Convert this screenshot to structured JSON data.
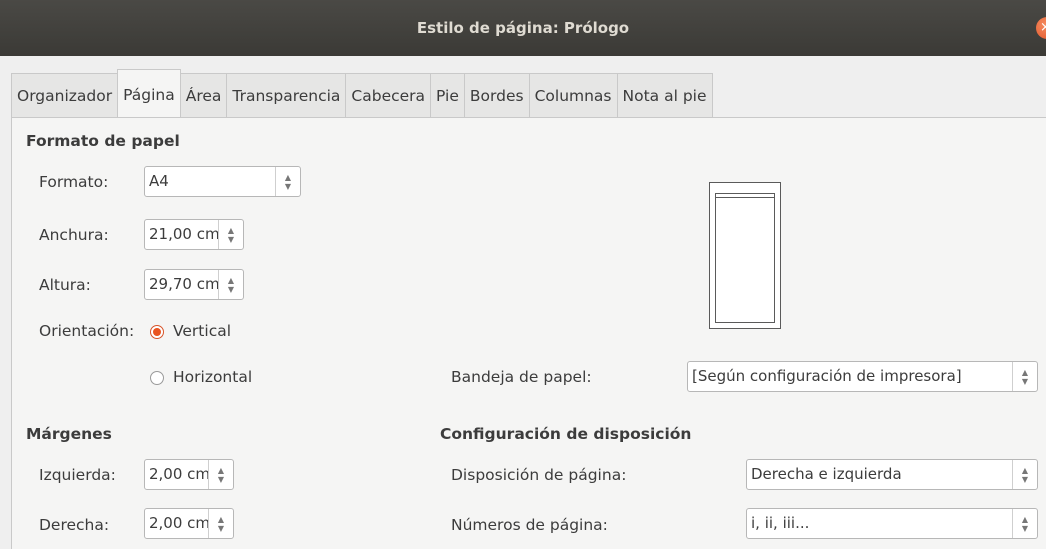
{
  "window": {
    "title": "Estilo de página: Prólogo",
    "close_symbol": "×"
  },
  "tabs": [
    {
      "label": "Organizador"
    },
    {
      "label": "Página",
      "active": true
    },
    {
      "label": "Área"
    },
    {
      "label": "Transparencia"
    },
    {
      "label": "Cabecera"
    },
    {
      "label": "Pie"
    },
    {
      "label": "Bordes"
    },
    {
      "label": "Columnas"
    },
    {
      "label": "Nota al pie"
    }
  ],
  "paper_format": {
    "section_title": "Formato de papel",
    "format": {
      "label": "Formato:",
      "value": "A4"
    },
    "width": {
      "label": "Anchura:",
      "value": "21,00 cm"
    },
    "height": {
      "label": "Altura:",
      "value": "29,70 cm"
    },
    "orientation": {
      "label": "Orientación:",
      "vertical": "Vertical",
      "horizontal": "Horizontal",
      "selected": "Vertical"
    },
    "paper_tray": {
      "label": "Bandeja de papel:",
      "value": "[Según configuración de impresora]"
    }
  },
  "margins": {
    "section_title": "Márgenes",
    "left": {
      "label": "Izquierda:",
      "value": "2,00 cm"
    },
    "right": {
      "label": "Derecha:",
      "value": "2,00 cm"
    }
  },
  "layout_settings": {
    "section_title": "Configuración de disposición",
    "page_layout": {
      "label": "Disposición de página:",
      "value": "Derecha e izquierda"
    },
    "page_numbers": {
      "label": "Números de página:",
      "value": "i, ii, iii..."
    }
  },
  "colors": {
    "accent": "#e95420",
    "titlebar": "#3b3a36"
  }
}
